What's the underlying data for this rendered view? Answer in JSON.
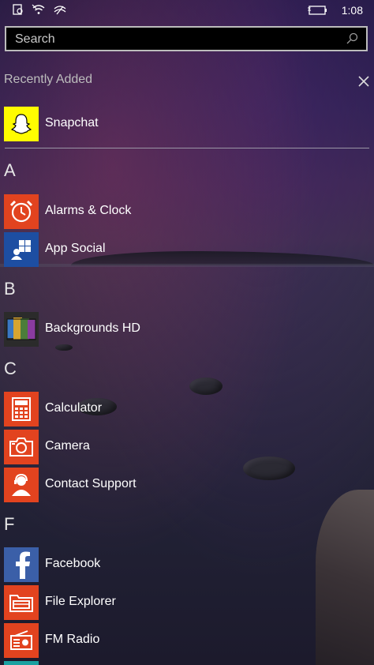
{
  "status_bar": {
    "time": "1:08"
  },
  "search": {
    "placeholder": "Search"
  },
  "recently_added": {
    "header": "Recently Added",
    "apps": [
      {
        "label": "Snapchat",
        "icon": "snapchat-ghost-icon",
        "color": "#fffc00"
      }
    ]
  },
  "sections": [
    {
      "letter": "A",
      "apps": [
        {
          "label": "Alarms & Clock",
          "icon": "alarm-clock-icon",
          "color": "#e2431f"
        },
        {
          "label": "App Social",
          "icon": "app-social-icon",
          "color": "#1d4ea2"
        }
      ]
    },
    {
      "letter": "B",
      "apps": [
        {
          "label": "Backgrounds HD",
          "icon": "backgrounds-hd-icon",
          "color": "#2b2b2b"
        }
      ]
    },
    {
      "letter": "C",
      "apps": [
        {
          "label": "Calculator",
          "icon": "calculator-icon",
          "color": "#e2431f"
        },
        {
          "label": "Camera",
          "icon": "camera-icon",
          "color": "#e2431f"
        },
        {
          "label": "Contact Support",
          "icon": "contact-support-icon",
          "color": "#e2431f"
        }
      ]
    },
    {
      "letter": "F",
      "apps": [
        {
          "label": "Facebook",
          "icon": "facebook-icon",
          "color": "#3b5fa8"
        },
        {
          "label": "File Explorer",
          "icon": "file-explorer-icon",
          "color": "#e2431f"
        },
        {
          "label": "FM Radio",
          "icon": "fm-radio-icon",
          "color": "#e2431f"
        }
      ]
    }
  ]
}
